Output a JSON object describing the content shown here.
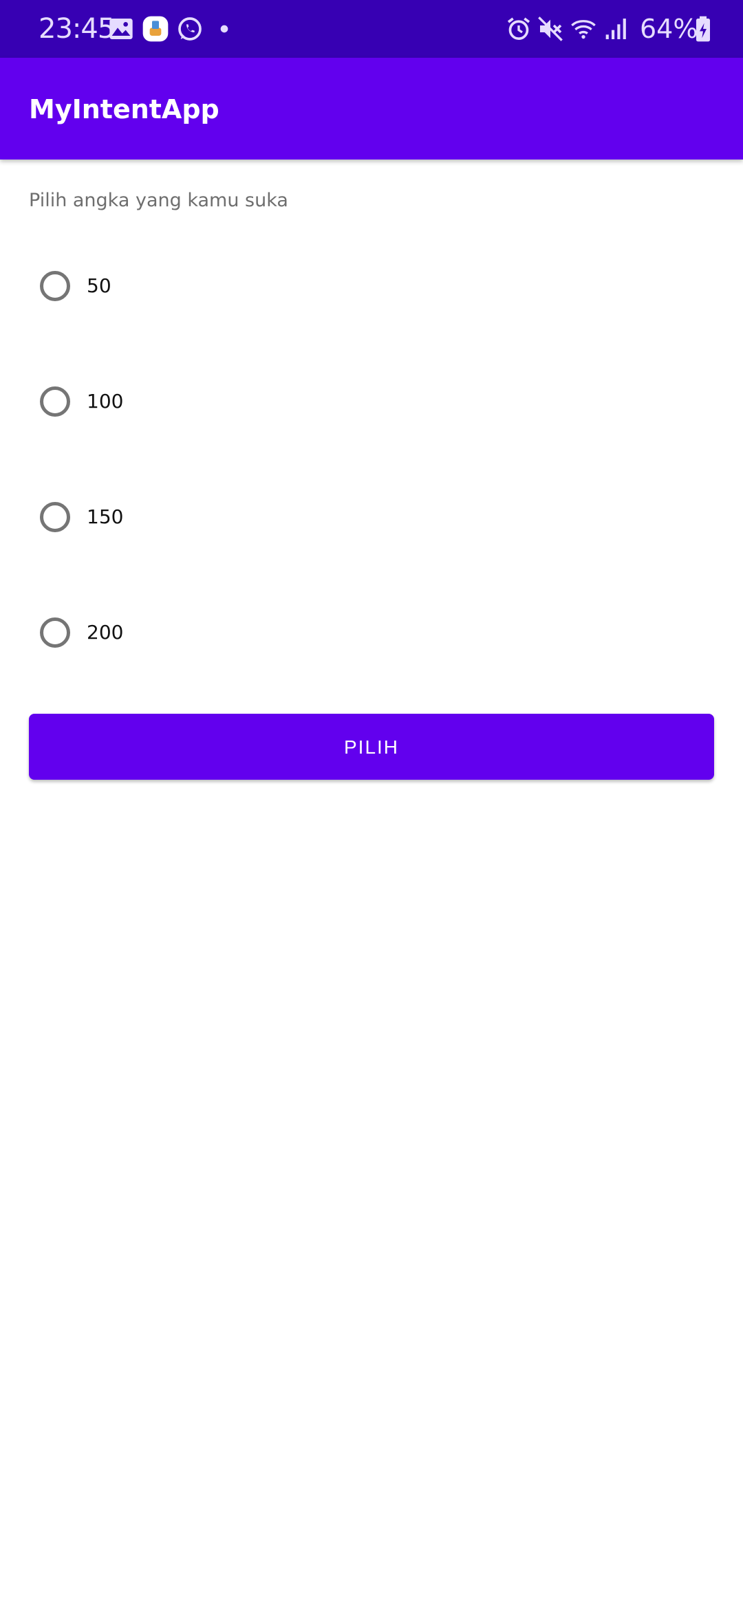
{
  "status_bar": {
    "time": "23:45",
    "battery": "64%",
    "icons": [
      "gallery-icon",
      "cleaner-app-icon",
      "whatsapp-icon",
      "notification-dot-icon",
      "alarm-icon",
      "mute-icon",
      "wifi-icon",
      "signal-icon",
      "battery-charging-icon"
    ]
  },
  "app_bar": {
    "title": "MyIntentApp"
  },
  "main": {
    "prompt": "Pilih angka yang kamu suka",
    "options": [
      {
        "label": "50",
        "selected": false
      },
      {
        "label": "100",
        "selected": false
      },
      {
        "label": "150",
        "selected": false
      },
      {
        "label": "200",
        "selected": false
      }
    ],
    "button_label": "PILIH"
  },
  "colors": {
    "status_bar": "#3700B3",
    "primary": "#6200EE",
    "radio_border": "#757575"
  }
}
